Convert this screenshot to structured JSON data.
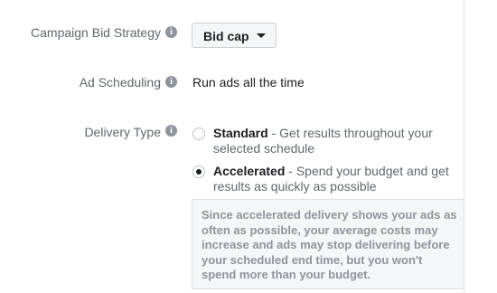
{
  "bid_strategy": {
    "label": "Campaign Bid Strategy",
    "info_icon": "info-icon",
    "selected": "Bid cap"
  },
  "ad_scheduling": {
    "label": "Ad Scheduling",
    "info_icon": "info-icon",
    "value": "Run ads all the time"
  },
  "delivery_type": {
    "label": "Delivery Type",
    "info_icon": "info-icon",
    "options": [
      {
        "title": "Standard",
        "separator": " - ",
        "description": "Get results throughout your selected schedule",
        "selected": false
      },
      {
        "title": "Accelerated",
        "separator": " - ",
        "description": "Spend your budget and get results as quickly as possible",
        "selected": true
      }
    ],
    "note": "Since accelerated delivery shows your ads as often as possible, your average costs may increase and ads may stop delivering before your scheduled end time, but you won't spend more than your budget."
  },
  "colors": {
    "label_gray": "#606770",
    "text_dark": "#1c1e21",
    "icon_gray": "#8d949e",
    "note_bg": "#f5f6f7",
    "note_text": "#90949c"
  }
}
